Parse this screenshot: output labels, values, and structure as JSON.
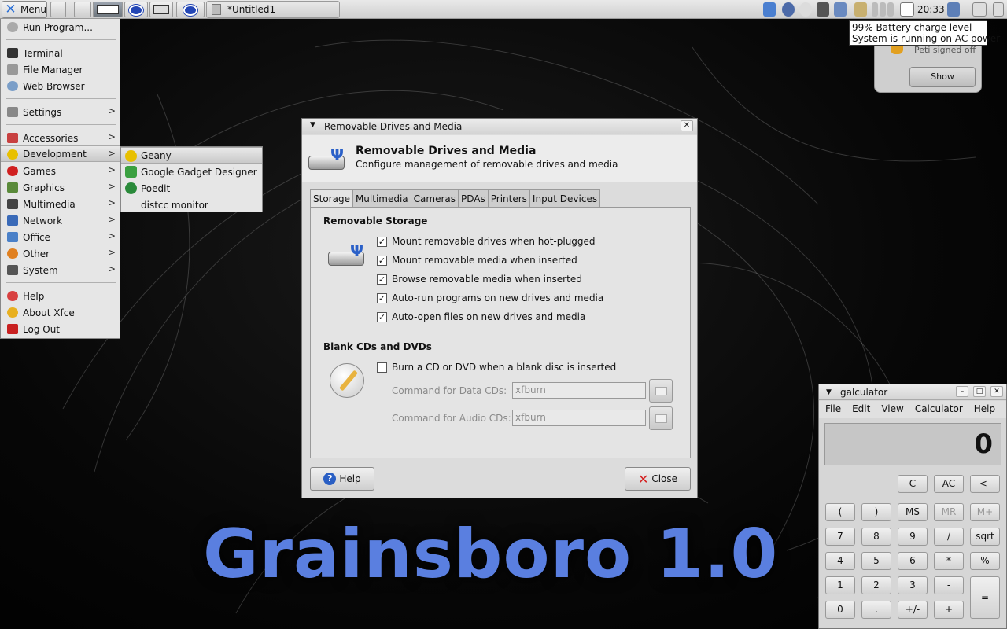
{
  "panel": {
    "menu_label": "Menu",
    "task_title": "*Untitled1",
    "clock": "20:33",
    "tooltip_line1": "99% Battery charge level",
    "tooltip_line2": "System is running on AC power"
  },
  "notification": {
    "text": "Peti signed off",
    "show_label": "Show"
  },
  "main_menu": {
    "run_program": "Run Program...",
    "terminal": "Terminal",
    "file_manager": "File Manager",
    "web_browser": "Web Browser",
    "settings": "Settings",
    "accessories": "Accessories",
    "development": "Development",
    "games": "Games",
    "graphics": "Graphics",
    "multimedia": "Multimedia",
    "network": "Network",
    "office": "Office",
    "other": "Other",
    "system": "System",
    "help": "Help",
    "about": "About Xfce",
    "logout": "Log Out"
  },
  "dev_submenu": {
    "geany": "Geany",
    "gadget": "Google Gadget Designer",
    "poedit": "Poedit",
    "distcc": "distcc monitor"
  },
  "dialog": {
    "title": "Removable Drives and Media",
    "header_title": "Removable Drives and Media",
    "header_subtitle": "Configure management of removable drives and media",
    "tabs": [
      "Storage",
      "Multimedia",
      "Cameras",
      "PDAs",
      "Printers",
      "Input Devices"
    ],
    "storage_section": "Removable Storage",
    "opt_mount_drives": "Mount removable drives when hot-plugged",
    "opt_mount_media": "Mount removable media when inserted",
    "opt_browse": "Browse removable media when inserted",
    "opt_autorun": "Auto-run programs on new drives and media",
    "opt_autoopen": "Auto-open files on new drives and media",
    "blank_section": "Blank CDs and DVDs",
    "opt_burn": "Burn a CD or DVD when a blank disc is inserted",
    "data_cd_label": "Command for Data CDs:",
    "data_cd_value": "xfburn",
    "audio_cd_label": "Command for Audio CDs:",
    "audio_cd_value": "xfburn",
    "help_label": "Help",
    "close_label": "Close"
  },
  "wallpaper_text": "Grainsboro 1.0",
  "calculator": {
    "title": "galculator",
    "menu": [
      "File",
      "Edit",
      "View",
      "Calculator",
      "Help"
    ],
    "display": "0",
    "keys_row0": [
      "C",
      "AC",
      "<-"
    ],
    "keys_row1": [
      "(",
      ")",
      "MS",
      "MR",
      "M+"
    ],
    "keys_row2": [
      "7",
      "8",
      "9",
      "/",
      "sqrt"
    ],
    "keys_row3": [
      "4",
      "5",
      "6",
      "*",
      "%"
    ],
    "keys_row4": [
      "1",
      "2",
      "3",
      "-",
      "="
    ],
    "keys_row5": [
      "0",
      ".",
      "+/-",
      "+"
    ]
  },
  "colors": {
    "accent_blue": "#5a7fe0",
    "menu_bg": "#e6e6e6",
    "dialog_bg": "#dcdcdc"
  }
}
